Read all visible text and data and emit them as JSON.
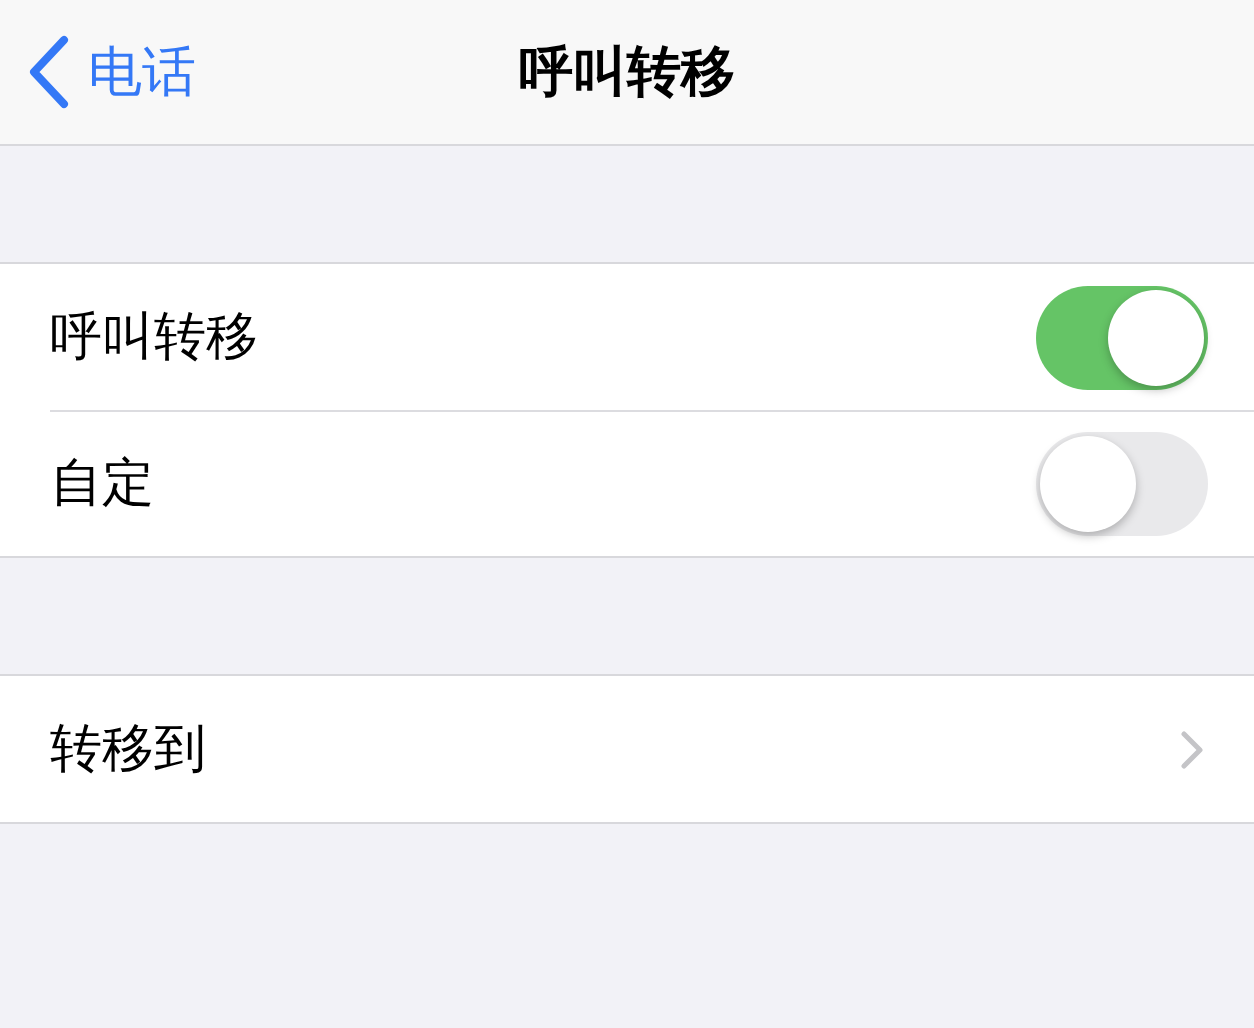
{
  "nav": {
    "back_label": "电话",
    "title": "呼叫转移"
  },
  "sections": [
    {
      "rows": [
        {
          "label": "呼叫转移",
          "kind": "toggle",
          "on": true
        },
        {
          "label": "自定",
          "kind": "toggle",
          "on": false
        }
      ]
    },
    {
      "rows": [
        {
          "label": "转移到",
          "kind": "link"
        }
      ]
    }
  ]
}
